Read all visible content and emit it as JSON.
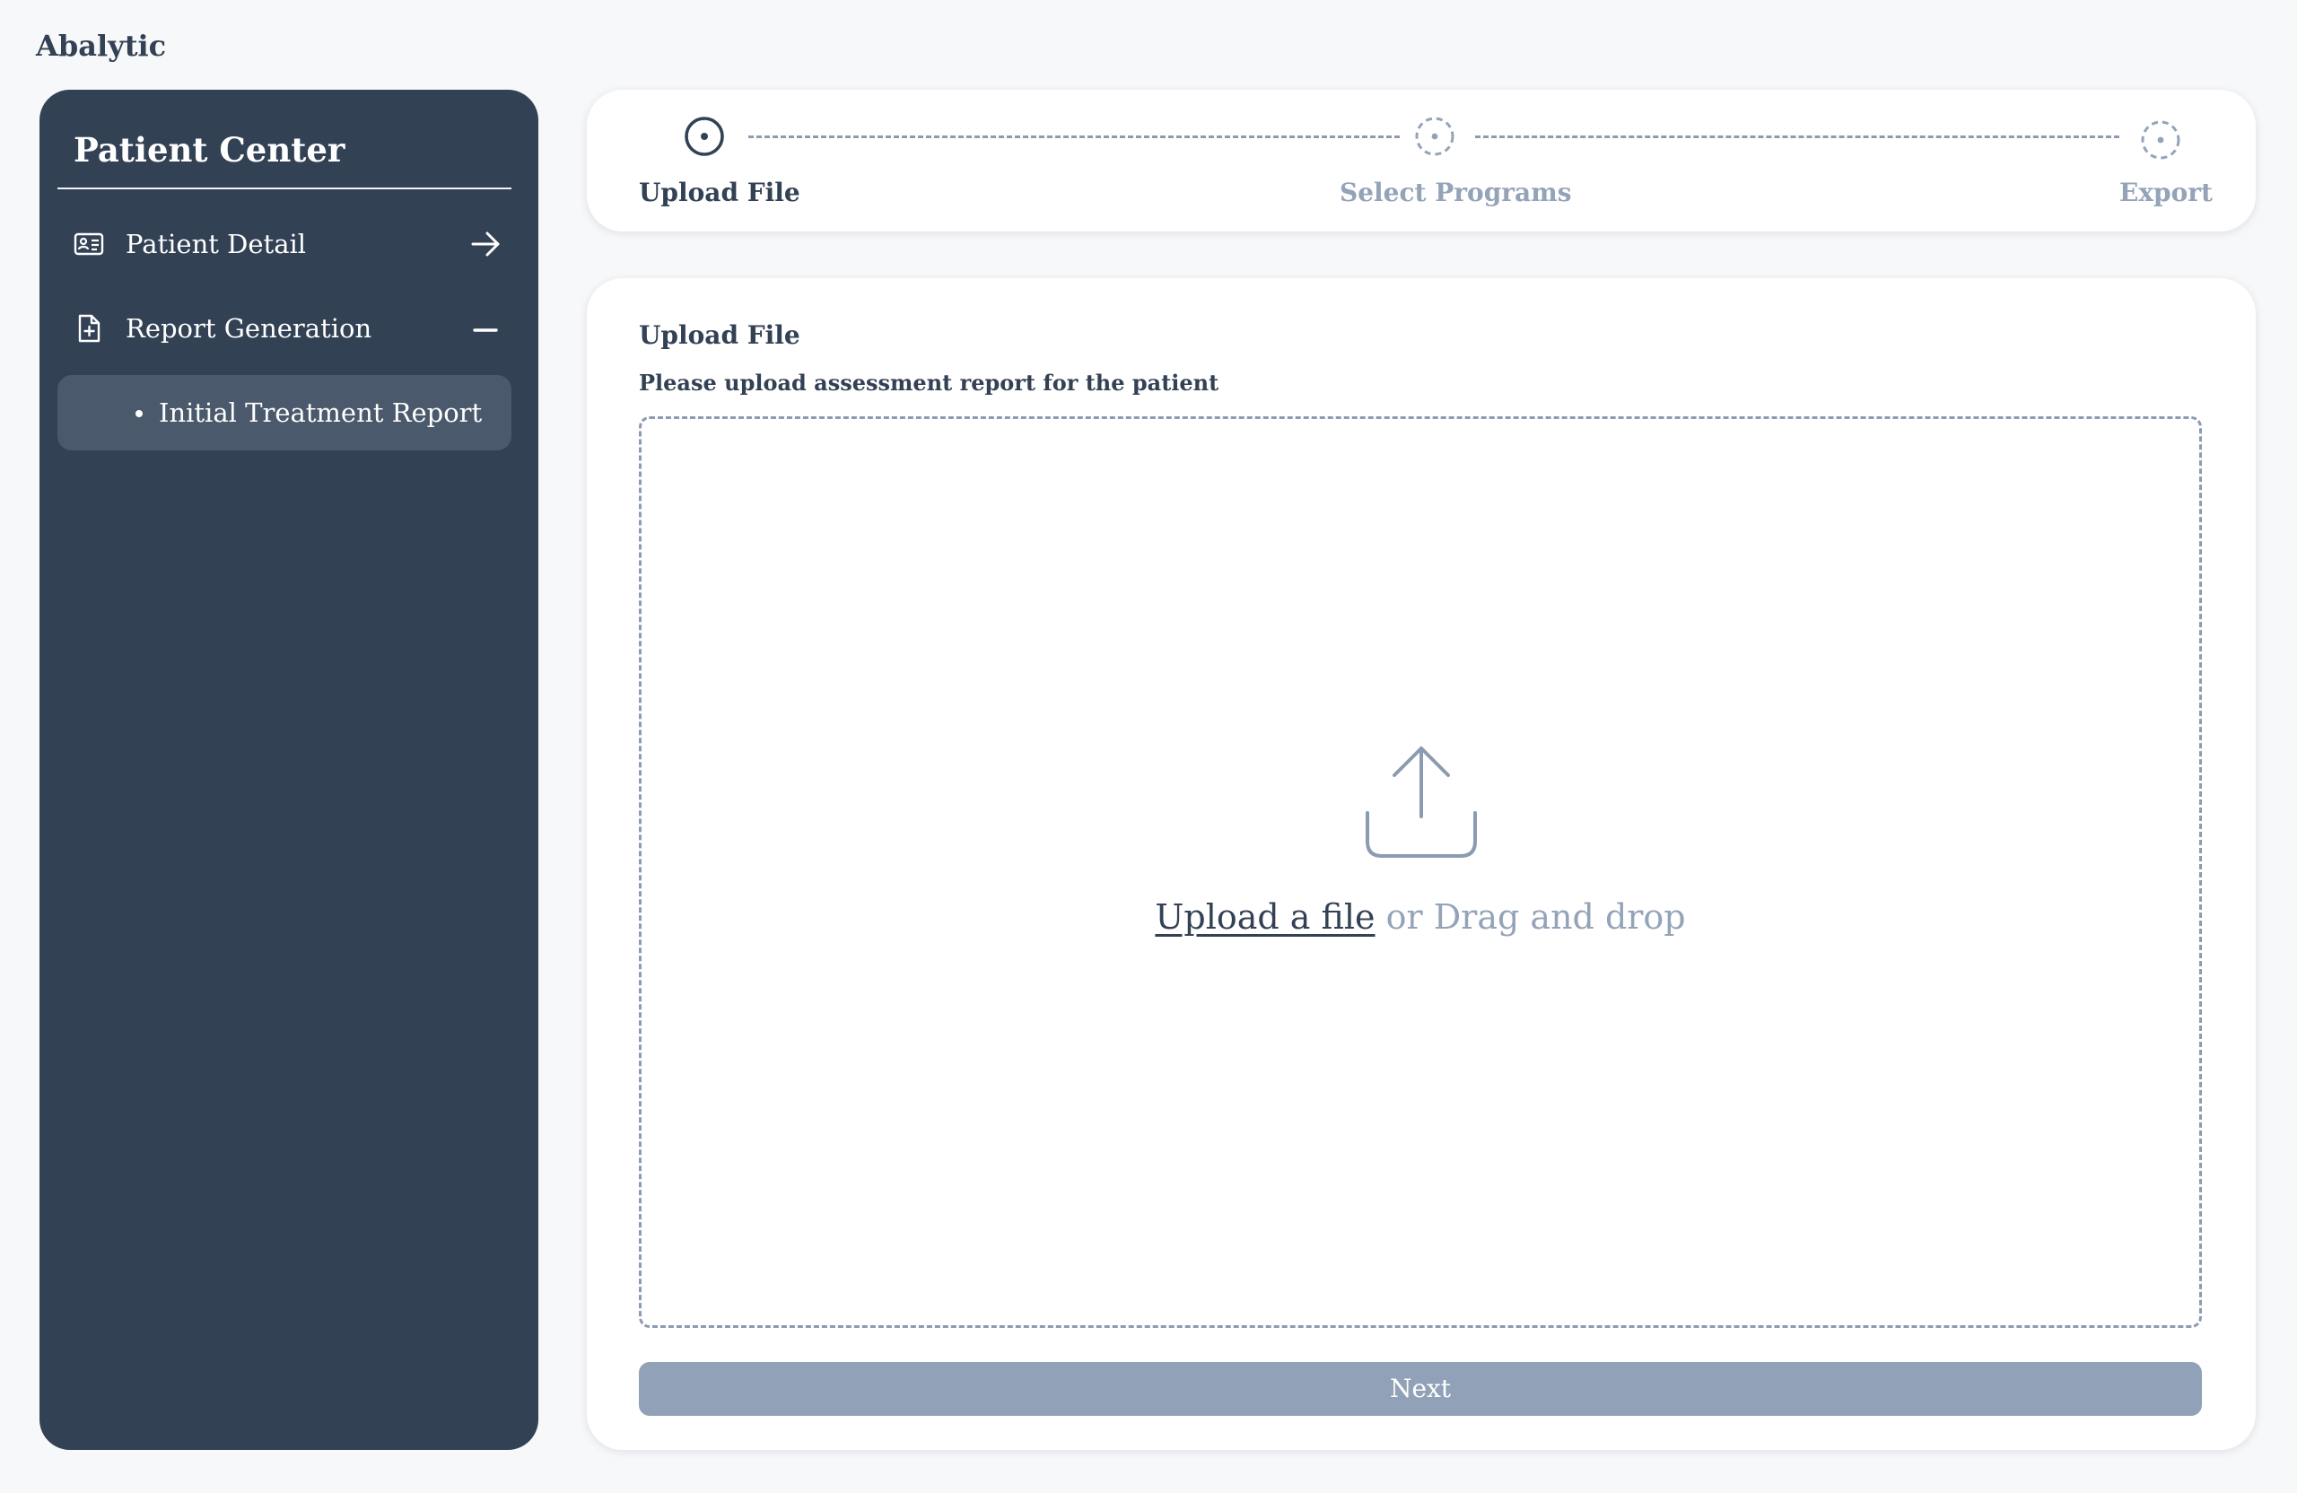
{
  "app": {
    "brand": "Abalytic"
  },
  "sidebar": {
    "title": "Patient Center",
    "items": [
      {
        "label": "Patient Detail",
        "icon": "id-card-icon",
        "trail_icon": "arrow-right-icon"
      },
      {
        "label": "Report Generation",
        "icon": "file-plus-icon",
        "trail_icon": "minus-icon",
        "expanded": true,
        "children": [
          {
            "label": "Initial Treatment Report",
            "selected": true
          }
        ]
      }
    ]
  },
  "stepper": {
    "steps": [
      {
        "label": "Upload File",
        "state": "active",
        "icon": "step-active-icon"
      },
      {
        "label": "Select Programs",
        "state": "pending",
        "icon": "step-pending-icon"
      },
      {
        "label": "Export",
        "state": "pending",
        "icon": "step-pending-icon"
      }
    ]
  },
  "main": {
    "title": "Upload File",
    "description": "Please upload assessment report for the patient",
    "dropzone": {
      "icon": "upload-icon",
      "link_text": "Upload a file",
      "or_text": " or Drag and drop"
    },
    "next_label": "Next"
  },
  "colors": {
    "sidebar_bg": "#334155",
    "sidebar_selected_bg": "#4b596c",
    "text_dark": "#334155",
    "muted": "#94a3b8",
    "button_disabled_bg": "#91a1b8",
    "page_bg": "#f7f8fa"
  }
}
